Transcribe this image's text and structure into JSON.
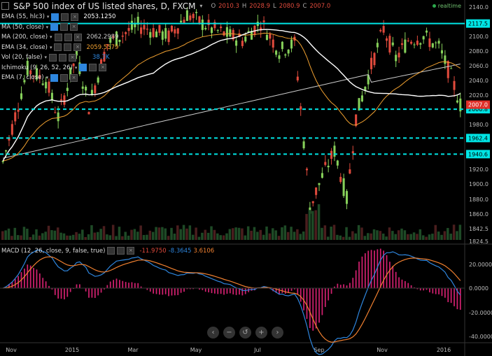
{
  "header": {
    "title": "S&P 500 index of US listed shares, D, FXCM",
    "o_label": "O",
    "o_value": "2010.3",
    "h_label": "H",
    "h_value": "2028.9",
    "l_label": "L",
    "l_value": "2080.9",
    "c_label": "C",
    "c_value": "2007.0",
    "realtime": "realtime"
  },
  "indicators": [
    {
      "name": "EMA (55, hlc3)",
      "value": "2053.1250",
      "color": "#ffffff"
    },
    {
      "name": "MA (50, close)",
      "value": "",
      "color": "#ffffff"
    },
    {
      "name": "MA (200, close)",
      "value": "2062.2989",
      "color": "#cccccc"
    },
    {
      "name": "EMA (34, close)",
      "value": "2059.5579",
      "color": "#f0a030"
    },
    {
      "name": "Vol (20, false)",
      "value": "38.7K",
      "color": "#2e86de"
    },
    {
      "name": "Ichimoku (9, 26, 52, 26)",
      "value": "",
      "color": "#ffffff"
    },
    {
      "name": "EMA (7, close)",
      "value": "",
      "color": "#ffffff"
    }
  ],
  "macd": {
    "label": "MACD (12, 26, close, 9, false, true)",
    "v1": "-11.9750",
    "v2": "-8.3645",
    "v3": "3.6106"
  },
  "nav_icons": [
    "chevron-left-icon",
    "zoom-out-icon",
    "reset-icon",
    "zoom-in-icon",
    "chevron-right-icon"
  ],
  "chart_data": {
    "type": "line",
    "price_axis": {
      "ticks": [
        2140.0,
        2120.0,
        2100.0,
        2080.0,
        2060.0,
        2040.0,
        2020.0,
        2000.0,
        1980.0,
        1960.0,
        1940.0,
        1920.0,
        1900.0,
        1880.0,
        1860.0,
        1842.5,
        1824.5
      ]
    },
    "macd_axis": {
      "ticks": [
        "20.0000",
        "0.0000",
        "-20.0000",
        "-40.0000"
      ]
    },
    "x_labels": [
      "Nov",
      "2015",
      "Mar",
      "May",
      "Jul",
      "Sep",
      "Nov",
      "2016"
    ],
    "levels": [
      {
        "label": "2117.5",
        "value": 2117.5
      },
      {
        "label": "2000.8",
        "value": 2000.8
      },
      {
        "label": "1962.4",
        "value": 1962.4
      },
      {
        "label": "1940.6",
        "value": 1940.6
      }
    ],
    "last_price": {
      "label": "2007.0",
      "value": 2007.0
    },
    "colors": {
      "up": "#86d05a",
      "down": "#e04a3c",
      "level": "#00e5e5",
      "macd": "#2e86de",
      "signal": "#f08030",
      "hist": "#d0206e",
      "ma200": "#cccccc",
      "ema34": "#f0a030",
      "ma50": "#ffffff"
    }
  }
}
